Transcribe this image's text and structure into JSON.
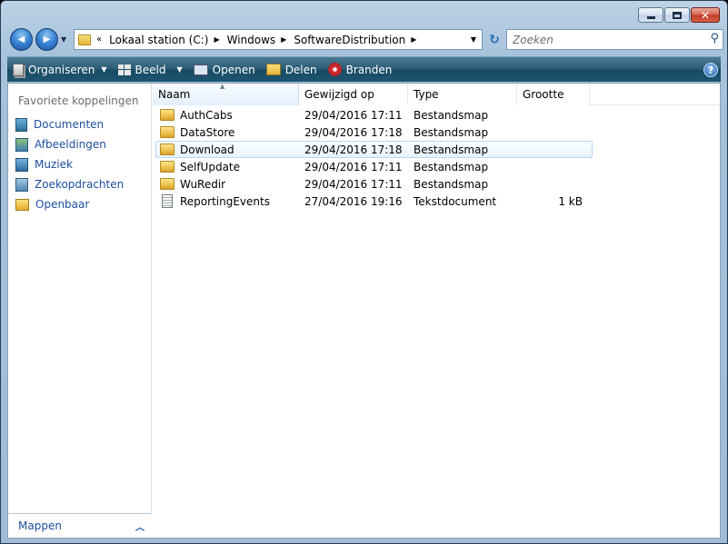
{
  "window": {
    "caption_minimize": "",
    "caption_maximize": "",
    "caption_close": "✕"
  },
  "nav": {
    "back_glyph": "◀",
    "forward_glyph": "▶",
    "breadcrumb_prefix": "«",
    "breadcrumbs": [
      "Lokaal station (C:)",
      "Windows",
      "SoftwareDistribution"
    ],
    "refresh_glyph": "↻"
  },
  "search": {
    "placeholder": "Zoeken",
    "icon": "search-icon"
  },
  "toolbar": {
    "organize_label": "Organiseren",
    "view_label": "Beeld",
    "open_label": "Openen",
    "share_label": "Delen",
    "burn_label": "Branden",
    "help_label": "?"
  },
  "sidebar": {
    "header": "Favoriete koppelingen",
    "items": [
      {
        "label": "Documenten",
        "icon": "documents-icon"
      },
      {
        "label": "Afbeeldingen",
        "icon": "pictures-icon"
      },
      {
        "label": "Muziek",
        "icon": "music-icon"
      },
      {
        "label": "Zoekopdrachten",
        "icon": "searches-icon"
      },
      {
        "label": "Openbaar",
        "icon": "public-folder-icon"
      }
    ],
    "folders_label": "Mappen"
  },
  "columns": {
    "name": "Naam",
    "date": "Gewijzigd op",
    "type": "Type",
    "size": "Grootte"
  },
  "files": [
    {
      "name": "AuthCabs",
      "date": "29/04/2016 17:11",
      "type": "Bestandsmap",
      "size": "",
      "kind": "folder"
    },
    {
      "name": "DataStore",
      "date": "29/04/2016 17:18",
      "type": "Bestandsmap",
      "size": "",
      "kind": "folder"
    },
    {
      "name": "Download",
      "date": "29/04/2016 17:18",
      "type": "Bestandsmap",
      "size": "",
      "kind": "folder"
    },
    {
      "name": "SelfUpdate",
      "date": "29/04/2016 17:11",
      "type": "Bestandsmap",
      "size": "",
      "kind": "folder"
    },
    {
      "name": "WuRedir",
      "date": "29/04/2016 17:11",
      "type": "Bestandsmap",
      "size": "",
      "kind": "folder"
    },
    {
      "name": "ReportingEvents",
      "date": "27/04/2016 19:16",
      "type": "Tekstdocument",
      "size": "1 kB",
      "kind": "text"
    }
  ]
}
